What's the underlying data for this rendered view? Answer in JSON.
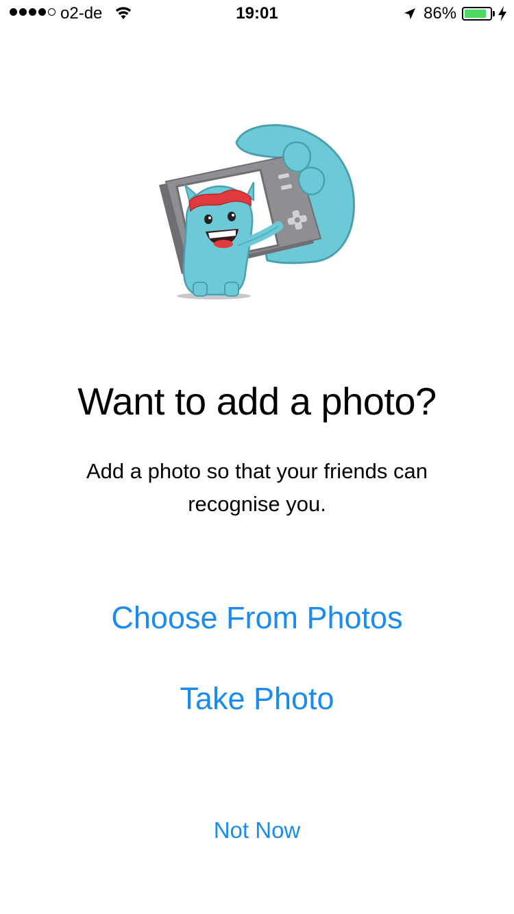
{
  "status_bar": {
    "carrier": "o2-de",
    "time": "19:01",
    "battery_percent_label": "86%",
    "battery_level": 0.86,
    "signal_bars_filled": 4,
    "signal_bars_total": 5,
    "icons": [
      "wifi-icon",
      "location-arrow-icon",
      "battery-icon",
      "charging-bolt-icon"
    ]
  },
  "illustration": {
    "icon": "monster-selfie-camera-illustration",
    "colors": {
      "monster_body": "#6ccad6",
      "monster_outline": "#4a9fb0",
      "camera_body": "#8e8e93",
      "monster_hat": "#e0393e"
    }
  },
  "content": {
    "title": "Want to add a photo?",
    "subtitle": "Add a photo so that your friends can recognise you."
  },
  "actions": {
    "choose_label": "Choose From Photos",
    "take_label": "Take Photo",
    "not_now_label": "Not Now"
  },
  "colors": {
    "accent": "#1a8cf0",
    "battery_fill": "#4cd964",
    "text": "#000000",
    "background": "#ffffff"
  }
}
